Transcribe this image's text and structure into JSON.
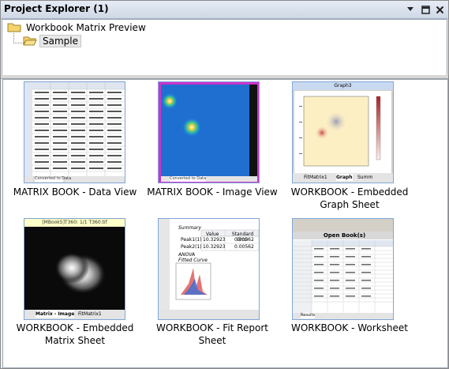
{
  "panel": {
    "title": "Project Explorer (1)"
  },
  "tree": {
    "root_label": "Workbook Matrix Preview",
    "child_label": "Sample"
  },
  "items": [
    {
      "caption": "MATRIX BOOK - Data View",
      "kind": "matrix-data",
      "tab_text": "Converted to Data"
    },
    {
      "caption": "MATRIX BOOK - Image View",
      "kind": "matrix-image",
      "tab_text": "Converted to Data"
    },
    {
      "caption": "WORKBOOK - Embedded Graph Sheet",
      "kind": "graph",
      "graph_title": "Graph3",
      "tabs": [
        "FitMatrix1",
        "Graph",
        "Summ"
      ]
    },
    {
      "caption": "WORKBOOK - Embedded Matrix Sheet",
      "kind": "emb-matrix",
      "header": "[MBook5]T360: 1/1 T360.tif",
      "tabs": [
        "Matrix - Image",
        "FitMatrix1"
      ]
    },
    {
      "caption": "WORKBOOK - Fit Report Sheet",
      "kind": "fit-report",
      "rows": [
        "Summary",
        "Peak1(1)",
        "Peak2(1)",
        "ANOVA",
        "Fitted Curve"
      ],
      "col_header": "Value",
      "col_header2": "Standard Error",
      "values": [
        "10.32923",
        "10.32923"
      ],
      "errors": [
        "0.00562",
        "0.00562"
      ]
    },
    {
      "caption": "WORKBOOK - Worksheet",
      "kind": "worksheet",
      "header": "Open Book(s)",
      "tab": "Results"
    }
  ]
}
